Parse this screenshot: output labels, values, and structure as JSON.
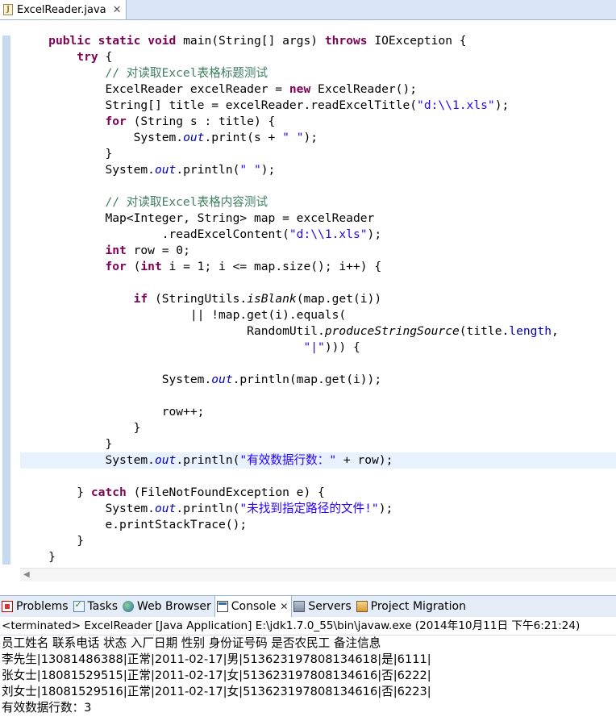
{
  "editor_tab": {
    "label": "ExcelReader.java",
    "icon": "java-file-icon",
    "close": "✕"
  },
  "code_lines": [
    {
      "indent": "    ",
      "tokens": [
        {
          "t": "public",
          "c": "kw"
        },
        {
          "t": " "
        },
        {
          "t": "static",
          "c": "kw"
        },
        {
          "t": " "
        },
        {
          "t": "void",
          "c": "kw"
        },
        {
          "t": " main(String[] args) "
        },
        {
          "t": "throws",
          "c": "kw"
        },
        {
          "t": " IOException {"
        }
      ]
    },
    {
      "indent": "        ",
      "tokens": [
        {
          "t": "try",
          "c": "kw"
        },
        {
          "t": " {"
        }
      ]
    },
    {
      "indent": "            ",
      "tokens": [
        {
          "t": "// 对读取Excel表格标题测试",
          "c": "cm"
        }
      ]
    },
    {
      "indent": "            ",
      "tokens": [
        {
          "t": "ExcelReader excelReader = "
        },
        {
          "t": "new",
          "c": "kw"
        },
        {
          "t": " ExcelReader();"
        }
      ]
    },
    {
      "indent": "            ",
      "tokens": [
        {
          "t": "String[] title = excelReader.readExcelTitle("
        },
        {
          "t": "\"d:\\\\1.xls\"",
          "c": "str"
        },
        {
          "t": ");"
        }
      ]
    },
    {
      "indent": "            ",
      "tokens": [
        {
          "t": "for",
          "c": "kw"
        },
        {
          "t": " (String s : title) {"
        }
      ]
    },
    {
      "indent": "                ",
      "tokens": [
        {
          "t": "System."
        },
        {
          "t": "out",
          "c": "fld"
        },
        {
          "t": ".print(s + "
        },
        {
          "t": "\" \"",
          "c": "str"
        },
        {
          "t": ");"
        }
      ]
    },
    {
      "indent": "            ",
      "tokens": [
        {
          "t": "}"
        }
      ]
    },
    {
      "indent": "            ",
      "tokens": [
        {
          "t": "System."
        },
        {
          "t": "out",
          "c": "fld"
        },
        {
          "t": ".println("
        },
        {
          "t": "\" \"",
          "c": "str"
        },
        {
          "t": ");"
        }
      ]
    },
    {
      "indent": "",
      "tokens": []
    },
    {
      "indent": "            ",
      "tokens": [
        {
          "t": "// 对读取Excel表格内容测试",
          "c": "cm"
        }
      ]
    },
    {
      "indent": "            ",
      "tokens": [
        {
          "t": "Map<Integer, String> map = excelReader"
        }
      ]
    },
    {
      "indent": "                    ",
      "tokens": [
        {
          "t": ".readExcelContent("
        },
        {
          "t": "\"d:\\\\1.xls\"",
          "c": "str"
        },
        {
          "t": ");"
        }
      ]
    },
    {
      "indent": "            ",
      "tokens": [
        {
          "t": "int",
          "c": "kw"
        },
        {
          "t": " row = 0;"
        }
      ]
    },
    {
      "indent": "            ",
      "tokens": [
        {
          "t": "for",
          "c": "kw"
        },
        {
          "t": " ("
        },
        {
          "t": "int",
          "c": "kw"
        },
        {
          "t": " i = 1; i <= map.size(); i++) {"
        }
      ]
    },
    {
      "indent": "",
      "tokens": []
    },
    {
      "indent": "                ",
      "tokens": [
        {
          "t": "if",
          "c": "kw"
        },
        {
          "t": " (StringUtils."
        },
        {
          "t": "isBlank",
          "c": "mi"
        },
        {
          "t": "(map.get(i))"
        }
      ]
    },
    {
      "indent": "                        ",
      "tokens": [
        {
          "t": "|| !map.get(i).equals("
        }
      ]
    },
    {
      "indent": "                                ",
      "tokens": [
        {
          "t": "RandomUtil."
        },
        {
          "t": "produceStringSource",
          "c": "mi"
        },
        {
          "t": "(title."
        },
        {
          "t": "length",
          "c": "fldn"
        },
        {
          "t": ","
        }
      ]
    },
    {
      "indent": "                                        ",
      "tokens": [
        {
          "t": "\"|\"",
          "c": "str"
        },
        {
          "t": "))) {"
        }
      ]
    },
    {
      "indent": "",
      "tokens": []
    },
    {
      "indent": "                    ",
      "tokens": [
        {
          "t": "System."
        },
        {
          "t": "out",
          "c": "fld"
        },
        {
          "t": ".println(map.get(i));"
        }
      ]
    },
    {
      "indent": "",
      "tokens": []
    },
    {
      "indent": "                    ",
      "tokens": [
        {
          "t": "row++;"
        }
      ]
    },
    {
      "indent": "                ",
      "tokens": [
        {
          "t": "}"
        }
      ]
    },
    {
      "indent": "            ",
      "tokens": [
        {
          "t": "}"
        }
      ]
    },
    {
      "indent": "            ",
      "current": true,
      "tokens": [
        {
          "t": "System."
        },
        {
          "t": "out",
          "c": "fld"
        },
        {
          "t": ".println("
        },
        {
          "t": "\"有效数据行数：\"",
          "c": "str"
        },
        {
          "t": " + row);"
        }
      ]
    },
    {
      "indent": "",
      "tokens": []
    },
    {
      "indent": "        ",
      "tokens": [
        {
          "t": "} "
        },
        {
          "t": "catch",
          "c": "kw"
        },
        {
          "t": " (FileNotFoundException e) {"
        }
      ]
    },
    {
      "indent": "            ",
      "tokens": [
        {
          "t": "System."
        },
        {
          "t": "out",
          "c": "fld"
        },
        {
          "t": ".println("
        },
        {
          "t": "\"未找到指定路径的文件!\"",
          "c": "str"
        },
        {
          "t": ");"
        }
      ]
    },
    {
      "indent": "            ",
      "tokens": [
        {
          "t": "e.printStackTrace();"
        }
      ]
    },
    {
      "indent": "        ",
      "tokens": [
        {
          "t": "}"
        }
      ]
    },
    {
      "indent": "    ",
      "tokens": [
        {
          "t": "}"
        }
      ]
    }
  ],
  "view_tabs": [
    {
      "name": "problems",
      "label": "Problems",
      "icon": "problems-icon",
      "active": false
    },
    {
      "name": "tasks",
      "label": "Tasks",
      "icon": "tasks-icon",
      "active": false
    },
    {
      "name": "web-browser",
      "label": "Web Browser",
      "icon": "browser-icon",
      "active": false
    },
    {
      "name": "console",
      "label": "Console",
      "icon": "console-icon",
      "active": true,
      "close": "✕"
    },
    {
      "name": "servers",
      "label": "Servers",
      "icon": "servers-icon",
      "active": false
    },
    {
      "name": "project-migration",
      "label": "Project Migration",
      "icon": "migration-icon",
      "active": false
    }
  ],
  "console": {
    "header": "<terminated> ExcelReader [Java Application] E:\\jdk1.7.0_55\\bin\\javaw.exe (2014年10月11日 下午6:21:24)",
    "lines": [
      "员工姓名 联系电话 状态 入厂日期 性别 身份证号码 是否农民工 备注信息",
      "李先生|13081486388|正常|2011-02-17|男|513623197808134618|是|6111|",
      "张女士|18081529515|正常|2011-02-17|女|513623197808134616|否|6222|",
      "刘女士|18081529516|正常|2011-02-17|女|513623197808134616|否|6223|",
      "有效数据行数：3"
    ]
  }
}
